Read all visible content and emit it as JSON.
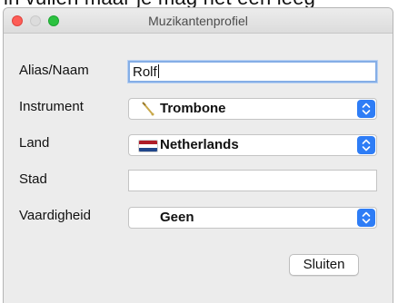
{
  "background_text": "in vullen maar je mag het een leeg",
  "window": {
    "title": "Muzikantenprofiel"
  },
  "form": {
    "alias": {
      "label": "Alias/Naam",
      "value": "Rolf"
    },
    "instrument": {
      "label": "Instrument",
      "value": "Trombone",
      "icon": "trombone-icon"
    },
    "country": {
      "label": "Land",
      "value": "Netherlands",
      "icon": "netherlands-flag-icon",
      "flag_colors": [
        "#ae1c28",
        "#ffffff",
        "#21468b"
      ]
    },
    "city": {
      "label": "Stad",
      "value": ""
    },
    "skill": {
      "label": "Vaardigheid",
      "value": "Geen"
    }
  },
  "buttons": {
    "close_label": "Sluiten"
  },
  "colors": {
    "accent": "#2e7df6",
    "focus_ring": "#85aee6",
    "close_light": "#fd5d57",
    "maximize_light": "#2cc240"
  }
}
